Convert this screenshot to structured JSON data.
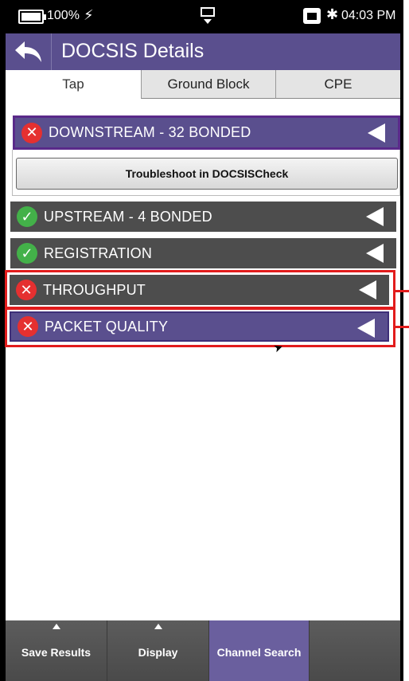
{
  "status_bar": {
    "battery": "100%",
    "time": "04:03 PM"
  },
  "header": {
    "title": "DOCSIS Details"
  },
  "tabs": [
    {
      "label": "Tap",
      "active": true
    },
    {
      "label": "Ground Block",
      "active": false
    },
    {
      "label": "CPE",
      "active": false
    }
  ],
  "sections": {
    "downstream": {
      "label": "DOWNSTREAM - 32 BONDED",
      "status": "fail"
    },
    "troubleshoot_button": "Troubleshoot in DOCSISCheck",
    "upstream": {
      "label": "UPSTREAM - 4 BONDED",
      "status": "pass"
    },
    "registration": {
      "label": "REGISTRATION",
      "status": "pass"
    },
    "throughput": {
      "label": "THROUGHPUT",
      "status": "fail"
    },
    "packet_quality": {
      "label": "PACKET QUALITY",
      "status": "fail"
    }
  },
  "toolbar": {
    "save_results": "Save Results",
    "display": "Display",
    "channel_search": "Channel Search"
  },
  "colors": {
    "header_purple": "#5a4f8e",
    "row_gray": "#4d4d4d",
    "fail_red": "#e53030",
    "pass_green": "#43b149",
    "highlight_red": "#e21c1c"
  },
  "icons": {
    "back": "back-arrow-icon",
    "fail": "x-circle-icon",
    "pass": "check-circle-icon",
    "collapse": "triangle-left-icon"
  }
}
